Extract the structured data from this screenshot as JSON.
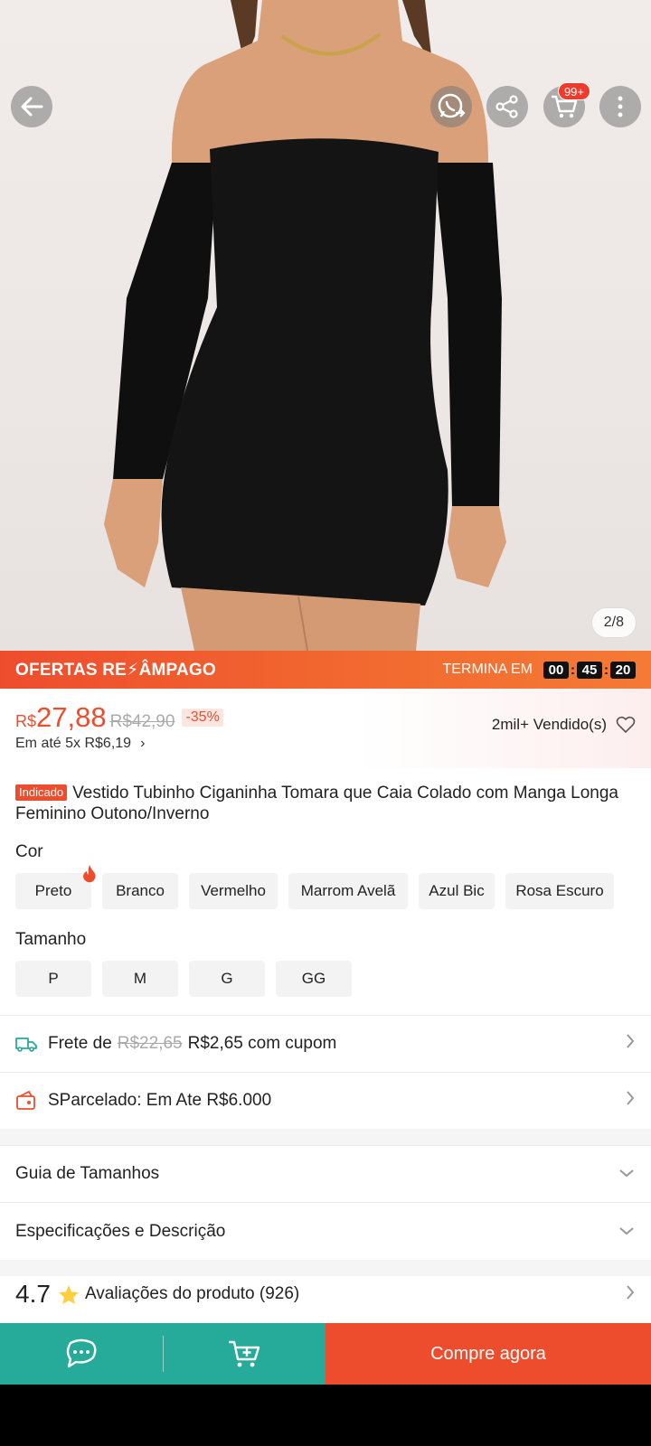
{
  "product": {
    "image_counter": "2/8",
    "cart_badge": "99+",
    "title_tag": "Indicado",
    "title": "Vestido Tubinho Ciganinha Tomara que Caia Colado com Manga Longa Feminino Outono/Inverno"
  },
  "flash": {
    "title": "OFERTAS RE⚡ÂMPAGO",
    "ends_label": "TERMINA EM",
    "hours": "00",
    "minutes": "45",
    "seconds": "20"
  },
  "price": {
    "currency": "R$",
    "current": "27,88",
    "original": "R$42,90",
    "discount": "-35%",
    "installments": "Em até 5x R$6,19",
    "sold": "2mil+ Vendido(s)"
  },
  "color": {
    "label": "Cor",
    "options": [
      "Preto",
      "Branco",
      "Vermelho",
      "Marrom Avelã",
      "Azul Bic",
      "Rosa Escuro"
    ]
  },
  "size": {
    "label": "Tamanho",
    "options": [
      "P",
      "M",
      "G",
      "GG"
    ]
  },
  "shipping": {
    "prefix": "Frete de",
    "old": "R$22,65",
    "new": "R$2,65 com cupom"
  },
  "installment_row": "SParcelado: Em Ate R$6.000",
  "size_guide": "Guia de Tamanhos",
  "specs": "Especificações e Descrição",
  "rating": {
    "score": "4.7",
    "label": "Avaliações do produto (926)"
  },
  "buy_now": "Compre agora",
  "icons": {
    "back": "arrow-left-icon",
    "whatsapp": "whatsapp-share-icon",
    "share": "share-icon",
    "cart": "cart-icon",
    "more": "more-vertical-icon",
    "chat": "chat-icon",
    "add_cart": "add-to-cart-icon"
  },
  "colors": {
    "accent": "#ee4d2d",
    "teal": "#26aa99"
  }
}
